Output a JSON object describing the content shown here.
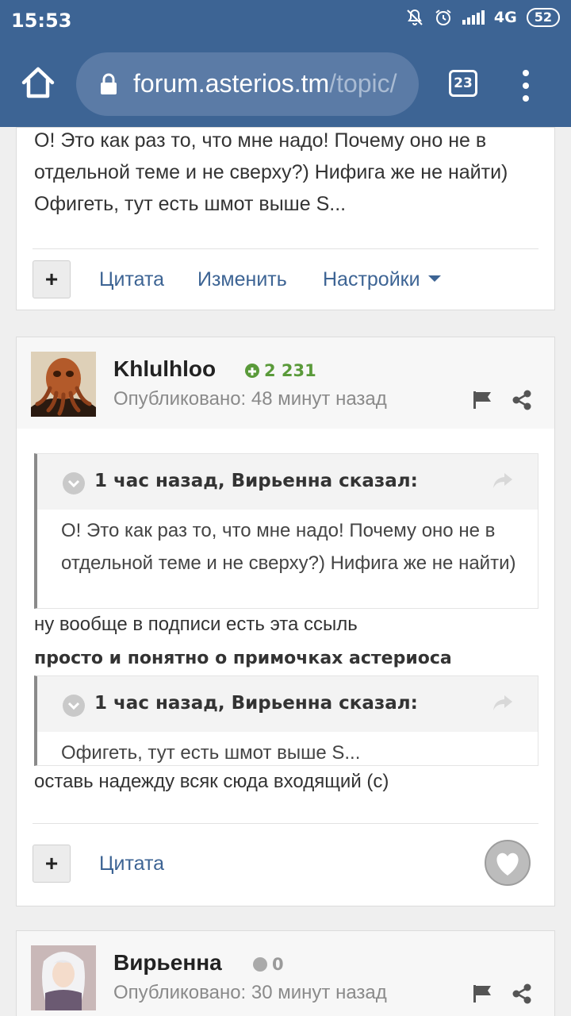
{
  "status_bar": {
    "time": "15:53",
    "network": "4G",
    "battery": "52",
    "icons": [
      "mute-bell-icon",
      "alarm-icon",
      "signal-icon",
      "battery-icon"
    ]
  },
  "browser": {
    "url_main": "forum.asterios.tm",
    "url_rest": "/topic/",
    "tab_count": "23",
    "colors": {
      "toolbar": "#3d6494",
      "url_box": "#5b7ba6"
    }
  },
  "post1": {
    "text": "О! Это как раз то, что мне надо! Почему оно не в отдельной теме и не сверху?) Нифига же не найти) Офигеть, тут есть шмот выше S...",
    "actions": {
      "plus": "+",
      "quote": "Цитата",
      "edit": "Изменить",
      "settings": "Настройки"
    }
  },
  "post2": {
    "author": "Khlulhloo",
    "reputation": "2 231",
    "reputation_color": "#5a9a3a",
    "published": "Опубликовано: 48 минут назад",
    "quote1": {
      "author": "1 час назад, Вирьенна сказал:",
      "text": "О! Это как раз то, что мне надо! Почему оно не в отдельной теме и не сверху?) Нифига же не найти)"
    },
    "line1": "ну вообще в подписи есть эта ссыль",
    "line2": "просто и понятно о примочках астериоса",
    "quote2": {
      "author": "1 час назад, Вирьенна сказал:",
      "text": "Офигеть, тут есть шмот выше S..."
    },
    "line3": "оставь надежду всяк сюда входящий (с)",
    "actions": {
      "plus": "+",
      "quote": "Цитата"
    }
  },
  "post3": {
    "author": "Вирьенна",
    "reputation": "0",
    "reputation_color": "#9a9a9a",
    "published": "Опубликовано: 30 минут назад"
  }
}
